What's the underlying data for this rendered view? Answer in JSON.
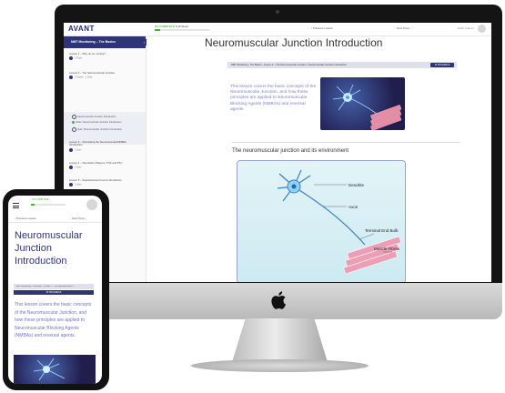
{
  "imac": {
    "app": {
      "logo": "AVANT",
      "progress_label": "0% COMPLETE",
      "progress_count": "1/10 Steps",
      "progress_fraction": 0.1,
      "prev_label": "‹ Previous Lesson",
      "next_label": "Next Topic ›",
      "user_label": "Hello, learner",
      "sidebar": {
        "course_title": "NMT Monitoring – The Basics",
        "lessons": [
          {
            "title": "Lesson 1 – Why do we monitor?",
            "meta": "1 Topic"
          },
          {
            "title": "Lesson 2 – The Neuromuscular Junction",
            "meta": "2 Topics · 1 Quiz"
          },
          {
            "title": "Lesson 3 – Stimulating the Neuromuscular/NMBAs Introduction",
            "meta": "1 Quiz"
          },
          {
            "title": "Lesson 4 – Stimulation Patterns: TOF and PTC",
            "meta": "1 Quiz"
          },
          {
            "title": "Lesson 5 – Supramaximal Current Introduction",
            "meta": "1 Quiz"
          },
          {
            "title": "Lesson 6 – Stimulation Sites (NMI)",
            "meta": "2 Topics · 1 Quiz"
          },
          {
            "title": "Lesson 7 – Stimulation Sites (NMI)",
            "meta": "1 Quiz"
          }
        ],
        "active_topics": [
          {
            "title": "Neuromuscular Junction Introduction",
            "state": "current"
          },
          {
            "title": "Video: Neuromuscular Junction Introduction",
            "state": "done"
          },
          {
            "title": "Quiz: Neuromuscular Junction Introduction",
            "state": "open"
          }
        ]
      },
      "main": {
        "title": "Neuromuscular Junction Introduction",
        "breadcrumb": "NMT Monitoring › The Basics › Lesson 2 – The Neuromuscular Junction › Neuromuscular Junction Introduction",
        "status_button": "IN PROGRESS",
        "intro": "This lesson covers the basic concepts of the Neuromuscular Junction, and how these principles are applied to Neuromuscular Blocking Agents (NMBAs) and reversal agents.",
        "section_title": "The neuromuscular junction and its environment",
        "diagram_labels": [
          "Dendrite",
          "Axon",
          "Terminal End Bulb",
          "Muscle Fibres"
        ]
      }
    }
  },
  "phone": {
    "logo": "AVANT",
    "progress_label": "0% COMPLETE",
    "progress_fraction": 0.1,
    "prev_label": "‹ Previous Lesson",
    "next_label": "Next Topic ›",
    "title": "Neuromuscular Junction Introduction",
    "breadcrumb": "NMT Monitoring › The Basics › Lesson 2 – The Neuromuscular J...",
    "status_button": "IN PROGRESS",
    "intro": "This lesson covers the basic concepts of the Neuromuscular Junction, and how these principles are applied to Neuromuscular Blocking Agents (NMBAs) and reversal agents."
  },
  "colors": {
    "brand_navy": "#2f3474",
    "progress_green": "#4cae3c",
    "intro_purple": "#7b7fc8"
  }
}
